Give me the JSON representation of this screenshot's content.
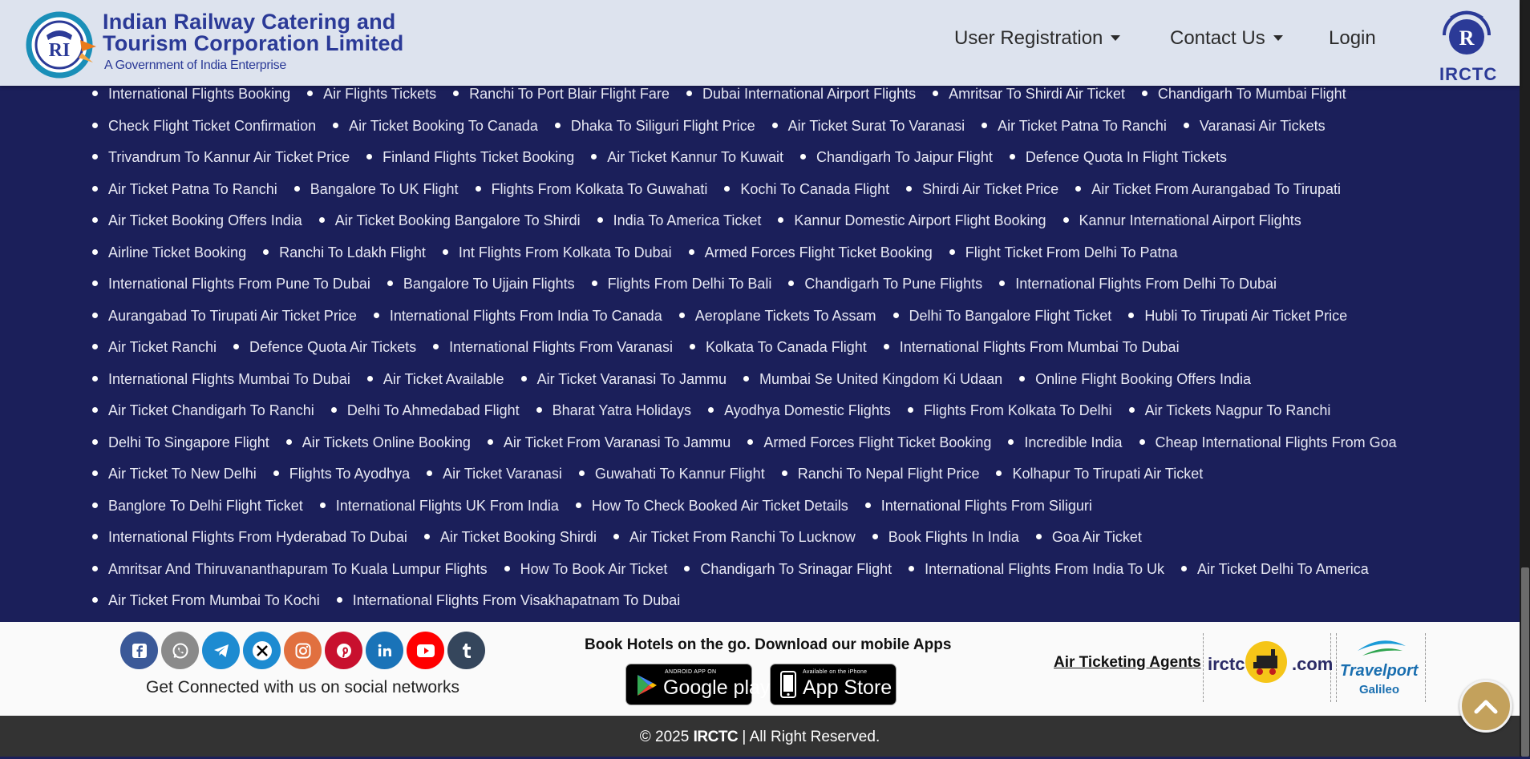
{
  "header": {
    "brand_line1": "Indian  Railway  Catering  and",
    "brand_line2": "Tourism Corporation Limited",
    "brand_sub": "A Government of India Enterprise",
    "nav": {
      "user_registration": "User Registration",
      "contact_us": "Contact Us",
      "login": "Login"
    },
    "irctc_logo_text": "IRCTC"
  },
  "links": [
    [
      "International Flights Booking",
      "Air Flights Tickets",
      "Ranchi To Port Blair Flight Fare",
      "Dubai International Airport Flights",
      "Amritsar To Shirdi Air Ticket",
      "Chandigarh To Mumbai Flight"
    ],
    [
      "Check Flight Ticket Confirmation",
      "Air Ticket Booking To Canada",
      "Dhaka To Siliguri Flight Price",
      "Air Ticket Surat To Varanasi",
      "Air Ticket Patna To Ranchi",
      "Varanasi Air Tickets"
    ],
    [
      "Trivandrum To Kannur Air Ticket Price",
      "Finland Flights Ticket Booking",
      "Air Ticket Kannur To Kuwait",
      "Chandigarh To Jaipur Flight",
      "Defence Quota In Flight Tickets"
    ],
    [
      "Air Ticket Patna To Ranchi",
      "Bangalore To UK Flight",
      "Flights From Kolkata To Guwahati",
      "Kochi To Canada Flight",
      "Shirdi Air Ticket Price",
      "Air Ticket From Aurangabad To Tirupati"
    ],
    [
      "Air Ticket Booking Offers India",
      "Air Ticket Booking Bangalore To Shirdi",
      "India To America Ticket",
      "Kannur Domestic Airport Flight Booking",
      "Kannur International Airport Flights"
    ],
    [
      "Airline Ticket Booking",
      "Ranchi To Ldakh Flight",
      "Int Flights From Kolkata To Dubai",
      "Armed Forces Flight Ticket Booking",
      "Flight Ticket From Delhi To Patna"
    ],
    [
      "International Flights From Pune To Dubai",
      "Bangalore To Ujjain Flights",
      "Flights From Delhi To Bali",
      "Chandigarh To Pune Flights",
      "International Flights From Delhi To Dubai"
    ],
    [
      "Aurangabad To Tirupati Air Ticket Price",
      "International Flights From India To Canada",
      "Aeroplane Tickets To Assam",
      "Delhi To Bangalore Flight Ticket",
      "Hubli To Tirupati Air Ticket Price"
    ],
    [
      "Air Ticket Ranchi",
      "Defence Quota Air Tickets",
      "International Flights From Varanasi",
      "Kolkata To Canada Flight",
      "International Flights From Mumbai To Dubai"
    ],
    [
      "International Flights Mumbai To Dubai",
      "Air Ticket Available",
      "Air Ticket Varanasi To Jammu",
      "Mumbai Se United Kingdom Ki Udaan",
      "Online Flight Booking Offers India"
    ],
    [
      "Air Ticket Chandigarh To Ranchi",
      "Delhi To Ahmedabad Flight",
      "Bharat Yatra Holidays",
      "Ayodhya Domestic Flights",
      "Flights From Kolkata To Delhi",
      "Air Tickets Nagpur To Ranchi"
    ],
    [
      "Delhi To Singapore Flight",
      "Air Tickets Online Booking",
      "Air Ticket From Varanasi To Jammu",
      "Armed Forces Flight Ticket Booking",
      "Incredible India",
      "Cheap International Flights From Goa"
    ],
    [
      "Air Ticket To New Delhi",
      "Flights To Ayodhya",
      "Air Ticket Varanasi",
      "Guwahati To Kannur Flight",
      "Ranchi To Nepal Flight Price",
      "Kolhapur To Tirupati Air Ticket"
    ],
    [
      "Banglore To Delhi Flight Ticket",
      "International Flights UK From India",
      "How To Check Booked Air Ticket Details",
      "International Flights From Siliguri"
    ],
    [
      "International Flights From Hyderabad To Dubai",
      "Air Ticket Booking Shirdi",
      "Air Ticket From Ranchi To Lucknow",
      "Book Flights In India",
      "Goa Air Ticket"
    ],
    [
      "Amritsar And Thiruvananthapuram To Kuala Lumpur Flights",
      "How To Book Air Ticket",
      "Chandigarh To Srinagar Flight",
      "International Flights From India To Uk",
      "Air Ticket Delhi To America"
    ],
    [
      "Air Ticket From Mumbai To Kochi",
      "International Flights From Visakhapatnam To Dubai"
    ]
  ],
  "footer": {
    "social": [
      {
        "name": "facebook",
        "color": "#3b5998"
      },
      {
        "name": "whatsapp",
        "color": "#8a8a8a"
      },
      {
        "name": "telegram",
        "color": "#1d8bd1"
      },
      {
        "name": "x",
        "color": "#1d8bd1"
      },
      {
        "name": "instagram",
        "color": "#e1703f"
      },
      {
        "name": "pinterest",
        "color": "#c8102e"
      },
      {
        "name": "linkedin",
        "color": "#1a73b8"
      },
      {
        "name": "youtube",
        "color": "#ff0000"
      },
      {
        "name": "tumblr",
        "color": "#35465c"
      }
    ],
    "social_caption": "Get Connected with us on social networks",
    "apps_title": "Book Hotels on the go. Download our mobile Apps",
    "google_play": {
      "small": "ANDROID APP ON",
      "big": "Google play"
    },
    "app_store": {
      "small": "Available on the iPhone",
      "big": "App Store"
    },
    "agents_label": "Air Ticketing Agents",
    "partner_irctc_left": "irctc",
    "partner_irctc_right": ".com",
    "partner_travelport": "Travelport",
    "partner_galileo": "Galileo"
  },
  "copyright": {
    "prefix": "© 2025 ",
    "brand": "IRCTC",
    "suffix": " | All Right Reserved."
  },
  "colors": {
    "brand_blue": "#2b3a97",
    "links_background": "#1b1f5a",
    "header_background": "#dde3ee",
    "footer_bar": "#333333",
    "scroll_top": "#c3a15c"
  }
}
